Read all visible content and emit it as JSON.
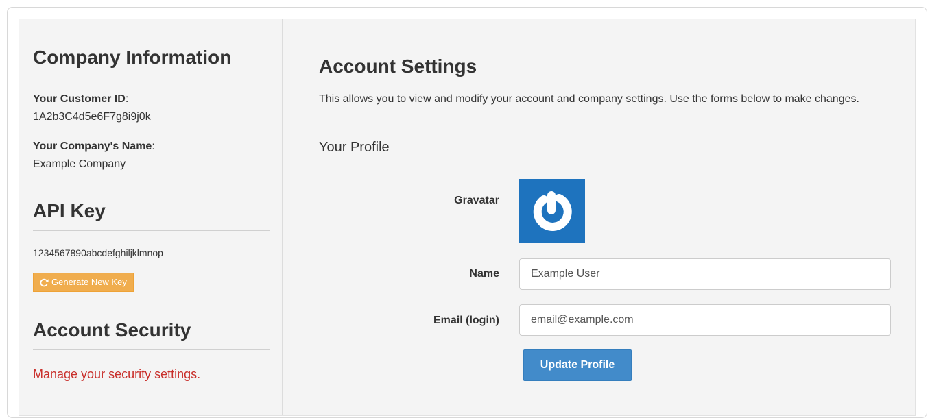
{
  "sidebar": {
    "company_heading": "Company Information",
    "customer_id_label": "Your Customer ID",
    "customer_id_colon": ":",
    "customer_id": "1A2b3C4d5e6F7g8i9j0k",
    "company_name_label": "Your Company's Name",
    "company_name_colon": ":",
    "company_name": "Example Company",
    "api_heading": "API Key",
    "api_key": "1234567890abcdefghiljklmnop",
    "generate_button": "Generate New Key",
    "security_heading": "Account Security",
    "security_link": "Manage your security settings."
  },
  "main": {
    "title": "Account Settings",
    "intro": "This allows you to view and modify your account and company settings. Use the forms below to make changes.",
    "profile_heading": "Your Profile",
    "gravatar_label": "Gravatar",
    "name_label": "Name",
    "name_value": "Example User",
    "email_label": "Email (login)",
    "email_value": "email@example.com",
    "update_button": "Update Profile"
  },
  "icons": {
    "refresh": "refresh-icon",
    "gravatar": "gravatar-logo"
  },
  "colors": {
    "warning_button": "#f0ad4e",
    "primary_button": "#428bca",
    "gravatar_bg": "#1e73be",
    "security_link": "#c9302c",
    "panel_bg": "#f4f4f4"
  }
}
